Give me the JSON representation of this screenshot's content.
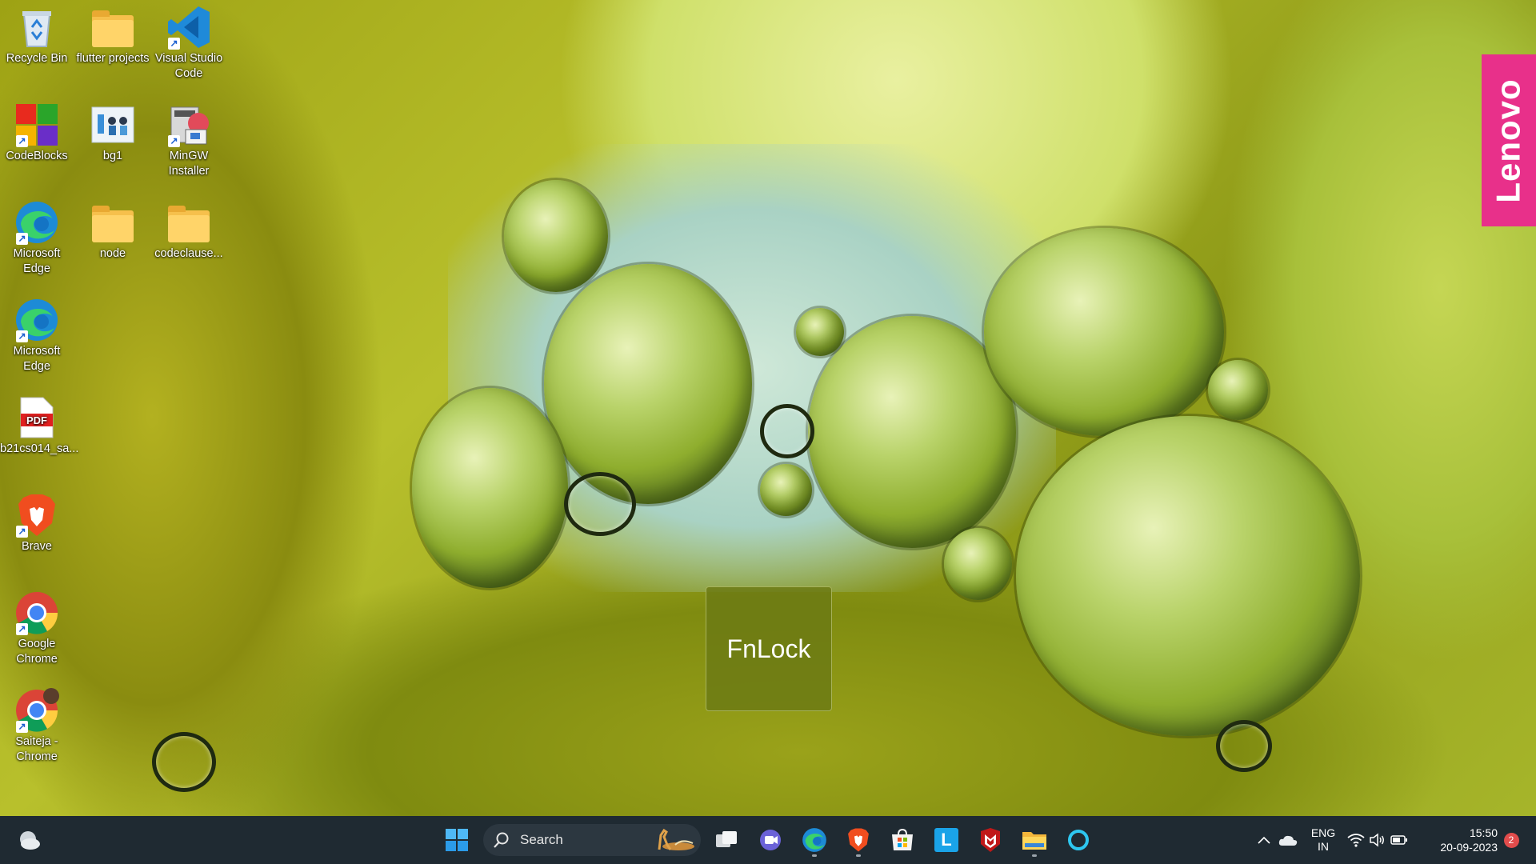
{
  "wallpaper": {
    "brand_tag": "Lenovo",
    "accent": "#e8308a"
  },
  "desktop_icons": [
    {
      "id": "recycle-bin",
      "label": "Recycle Bin",
      "icon": "recycle-bin-icon"
    },
    {
      "id": "flutter-projects",
      "label": "flutter projects",
      "icon": "folder-icon"
    },
    {
      "id": "vscode",
      "label": "Visual Studio Code",
      "icon": "vscode-icon"
    },
    {
      "id": "codeblocks",
      "label": "CodeBlocks",
      "icon": "codeblocks-icon"
    },
    {
      "id": "bg1",
      "label": "bg1",
      "icon": "image-icon"
    },
    {
      "id": "mingw",
      "label": "MinGW Installer",
      "icon": "installer-icon"
    },
    {
      "id": "edge-1",
      "label": "Microsoft Edge",
      "icon": "edge-icon"
    },
    {
      "id": "node",
      "label": "node",
      "icon": "folder-icon"
    },
    {
      "id": "codeclause",
      "label": "codeclause...",
      "icon": "folder-icon"
    },
    {
      "id": "edge-2",
      "label": "Microsoft Edge",
      "icon": "edge-icon"
    },
    {
      "id": "pdf",
      "label": "b21cs014_sa...",
      "icon": "pdf-icon",
      "badge": "PDF"
    },
    {
      "id": "brave",
      "label": "Brave",
      "icon": "brave-icon"
    },
    {
      "id": "chrome",
      "label": "Google Chrome",
      "icon": "chrome-icon"
    },
    {
      "id": "chrome-saiteja",
      "label": "Saiteja - Chrome",
      "icon": "chrome-profile-icon"
    }
  ],
  "osd": {
    "label": "FnLock"
  },
  "taskbar": {
    "search_label": "Search",
    "apps": [
      {
        "name": "task-view",
        "icon": "task-view-icon"
      },
      {
        "name": "meet",
        "icon": "meet-icon"
      },
      {
        "name": "edge",
        "icon": "edge-icon"
      },
      {
        "name": "brave",
        "icon": "brave-icon"
      },
      {
        "name": "store",
        "icon": "store-icon"
      },
      {
        "name": "lenovo-app",
        "icon": "l-app-icon",
        "glyph": "L"
      },
      {
        "name": "mcafee",
        "icon": "mcafee-icon"
      },
      {
        "name": "file-explorer",
        "icon": "folder-icon"
      },
      {
        "name": "cortana",
        "icon": "cortana-icon"
      }
    ],
    "tray": {
      "lang_top": "ENG",
      "lang_bottom": "IN",
      "time": "15:50",
      "date": "20-09-2023",
      "notification_count": "2"
    }
  }
}
